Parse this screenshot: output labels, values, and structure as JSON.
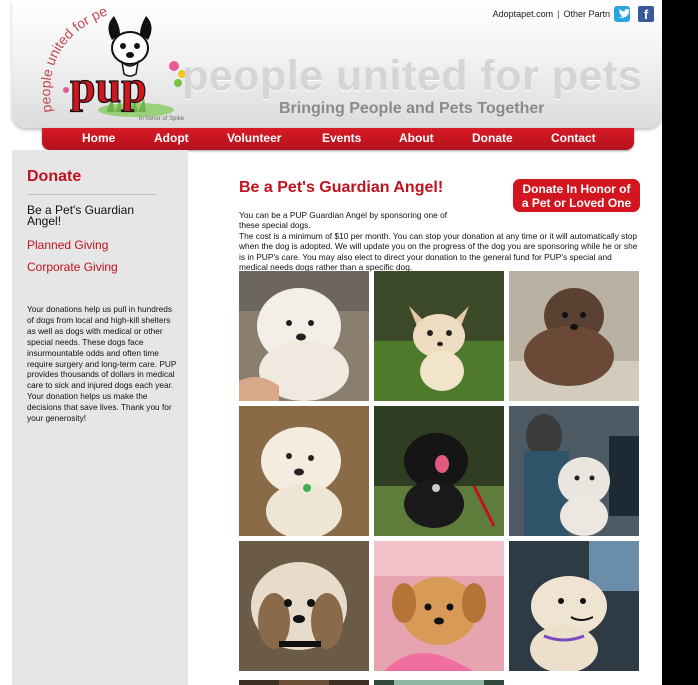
{
  "header": {
    "top_links": {
      "adopt": "Adoptapet.com",
      "separator": "|",
      "other": "Other Partn"
    },
    "social": [
      {
        "icon": "twitter-icon",
        "color": "#2ba5df"
      },
      {
        "icon": "facebook-icon",
        "color": "#3b5998",
        "glyph": "f"
      }
    ],
    "logo_arc": "people united for pets",
    "logo_word": "pup",
    "logo_honor": "in honor of Spike",
    "big_title": "people united for pets",
    "tagline": "Bringing People and Pets Together"
  },
  "nav": {
    "items": [
      "Home",
      "Adopt",
      "Volunteer",
      "Events",
      "About",
      "Donate",
      "Contact"
    ],
    "color": "#c8161f"
  },
  "sidebar": {
    "title": "Donate",
    "active": "Be a Pet's Guardian Angel!",
    "links": [
      "Planned Giving",
      "Corporate Giving"
    ],
    "text": "Your donations help us pull in hundreds of dogs from local and high-kill shelters as well as dogs with medical or other special needs. These dogs face insurmountable odds and often time require surgery and long-term care. PUP provides thousands of dollars in medical care to sick and injured dogs each year. Your donation helps us make the decisions that save lives. Thank you for your generosity!"
  },
  "main": {
    "title": "Be a Pet's Guardian Angel!",
    "donate_button_line1": "Donate In Honor of",
    "donate_button_line2": "a Pet or Loved One",
    "intro_line1": "You can be a PUP Guardian Angel by sponsoring one of these special dogs.",
    "intro_rest": "The cost is a minimum of $10 per month. You can stop your donation at any time or it will automatically stop when the dog is adopted. We will update you on the progress of the dog you are sponsoring while he or she is in PUP's care. You may also elect to direct your donation to the general fund for PUP's special and medical needs dogs rather than a specific dog.",
    "photos": [
      {
        "name": "dog-photo-white-fluffy"
      },
      {
        "name": "dog-photo-chihuahua-grass"
      },
      {
        "name": "dog-photo-long-hair-sofa"
      },
      {
        "name": "dog-photo-maltese"
      },
      {
        "name": "dog-photo-black-pom"
      },
      {
        "name": "dog-photo-vet-clinic"
      },
      {
        "name": "dog-photo-shih-tzu"
      },
      {
        "name": "dog-photo-puppy-held"
      },
      {
        "name": "dog-photo-white-in-car"
      },
      {
        "name": "dog-photo-partial-1"
      },
      {
        "name": "dog-photo-partial-2"
      }
    ]
  },
  "colors": {
    "brand_red": "#c0121e",
    "sidebar_bg": "#e6e6e6"
  }
}
